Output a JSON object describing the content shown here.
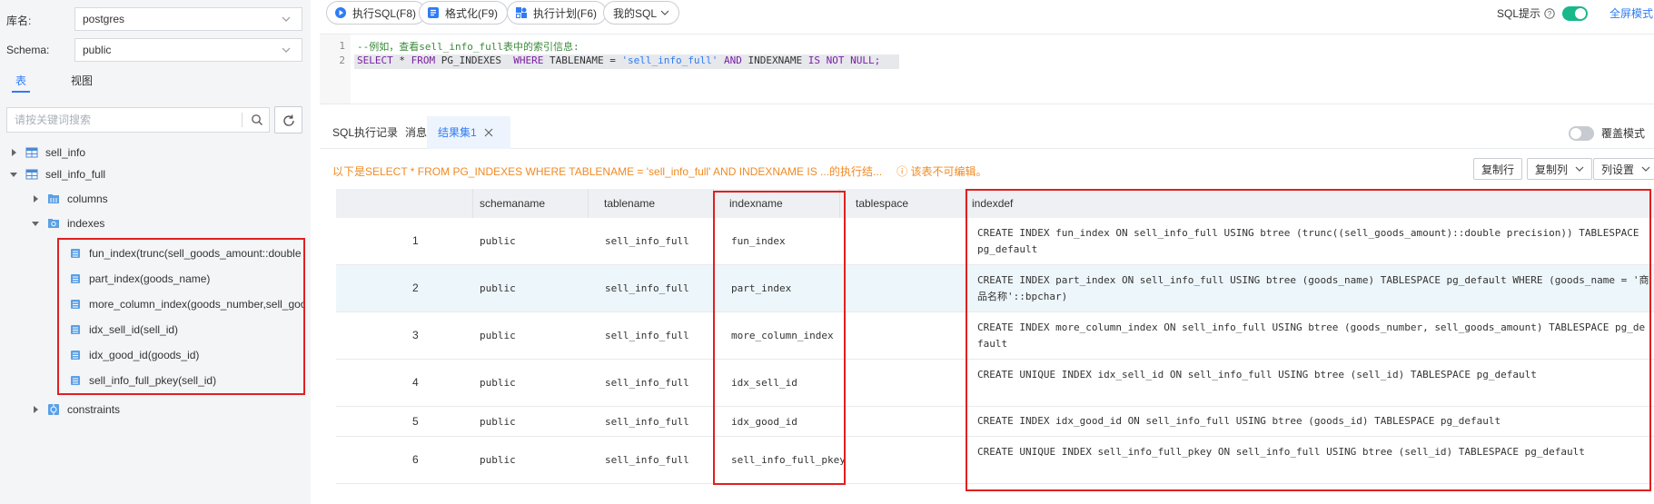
{
  "left_panel": {
    "db_label": "库名:",
    "db_value": "postgres",
    "schema_label": "Schema:",
    "schema_value": "public",
    "tabs": [
      "表",
      "视图"
    ],
    "search_placeholder": "请按关键词搜索",
    "tree": {
      "table1": "sell_info",
      "table2": "sell_info_full",
      "columns": "columns",
      "indexes": "indexes",
      "index_items": [
        "fun_index(trunc(sell_goods_amount::double precision))",
        "part_index(goods_name)",
        "more_column_index(goods_number,sell_goods_amount)",
        "idx_sell_id(sell_id)",
        "idx_good_id(goods_id)",
        "sell_info_full_pkey(sell_id)"
      ],
      "constraints": "constraints"
    }
  },
  "toolbar": {
    "execute": "执行SQL(F8)",
    "format": "格式化(F9)",
    "plan": "执行计划(F6)",
    "my_sql": "我的SQL",
    "sql_hint": "SQL提示",
    "fullscreen": "全屏模式"
  },
  "editor": {
    "line1_num": "1",
    "line2_num": "2",
    "comment": "--例如，查看sell_info_full表中的索引信息:",
    "sql_select": "SELECT",
    "sql_star": " * ",
    "sql_from": "FROM",
    "sql_table": " PG_INDEXES  ",
    "sql_where": "WHERE",
    "sql_col1": " TABLENAME = ",
    "sql_str": "'sell_info_full'",
    "sql_and": " AND",
    "sql_col2": " INDEXNAME ",
    "sql_is": "IS",
    "sql_not": " NOT",
    "sql_null": " NULL;"
  },
  "result_tabs": {
    "history": "SQL执行记录",
    "messages": "消息",
    "resultset": "结果集1",
    "cover_mode": "覆盖模式"
  },
  "result_info": {
    "summary": "以下是SELECT * FROM PG_INDEXES WHERE TABLENAME = 'sell_info_full' AND INDEXNAME IS ...的执行结...",
    "warning": "该表不可编辑。",
    "copy_row": "复制行",
    "copy_col": "复制列",
    "col_settings": "列设置"
  },
  "grid": {
    "headers": [
      "",
      "schemaname",
      "tablename",
      "indexname",
      "tablespace",
      "indexdef"
    ],
    "rows": [
      {
        "num": "1",
        "schemaname": "public",
        "tablename": "sell_info_full",
        "indexname": "fun_index",
        "tablespace": "",
        "indexdef": "CREATE INDEX fun_index ON sell_info_full USING btree (trunc((sell_goods_amount)::double precision)) TABLESPACE pg_default"
      },
      {
        "num": "2",
        "schemaname": "public",
        "tablename": "sell_info_full",
        "indexname": "part_index",
        "tablespace": "",
        "indexdef": "CREATE INDEX part_index ON sell_info_full USING btree (goods_name) TABLESPACE pg_default WHERE (goods_name = '商品名称'::bpchar)"
      },
      {
        "num": "3",
        "schemaname": "public",
        "tablename": "sell_info_full",
        "indexname": "more_column_index",
        "tablespace": "",
        "indexdef": "CREATE INDEX more_column_index ON sell_info_full USING btree (goods_number, sell_goods_amount) TABLESPACE pg_default"
      },
      {
        "num": "4",
        "schemaname": "public",
        "tablename": "sell_info_full",
        "indexname": "idx_sell_id",
        "tablespace": "",
        "indexdef": "CREATE UNIQUE INDEX idx_sell_id ON sell_info_full USING btree (sell_id) TABLESPACE pg_default"
      },
      {
        "num": "5",
        "schemaname": "public",
        "tablename": "sell_info_full",
        "indexname": "idx_good_id",
        "tablespace": "",
        "indexdef": "CREATE INDEX idx_good_id ON sell_info_full USING btree (goods_id) TABLESPACE pg_default"
      },
      {
        "num": "6",
        "schemaname": "public",
        "tablename": "sell_info_full",
        "indexname": "sell_info_full_pkey",
        "tablespace": "",
        "indexdef": "CREATE UNIQUE INDEX sell_info_full_pkey ON sell_info_full USING btree (sell_id) TABLESPACE pg_default"
      }
    ]
  },
  "colors": {
    "accent": "#2e7cf6",
    "highlight_border": "#e02020",
    "warning_text": "#f08a24",
    "toggle_on": "#19b88a",
    "alt_row": "#edf6fa"
  },
  "icons": {
    "run": "play-icon",
    "format": "format-icon",
    "plan": "plan-icon",
    "search": "search-icon",
    "refresh": "refresh-icon",
    "table": "table-icon",
    "folder": "folder-icon",
    "index": "index-icon",
    "constraint": "constraint-icon"
  }
}
